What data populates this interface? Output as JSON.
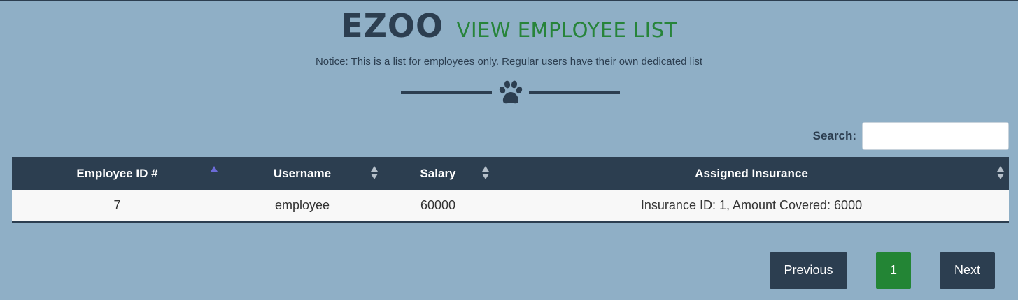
{
  "header": {
    "brand": "EZOO",
    "subtitle": "VIEW EMPLOYEE LIST",
    "notice": "Notice: This is a list for employees only. Regular users have their own dedicated list",
    "divider_icon": "paw-icon"
  },
  "search": {
    "label": "Search:",
    "value": "",
    "placeholder": ""
  },
  "table": {
    "columns": [
      {
        "label": "Employee ID #",
        "sort": "ascending"
      },
      {
        "label": "Username",
        "sort": "none"
      },
      {
        "label": "Salary",
        "sort": "none"
      },
      {
        "label": "Assigned Insurance",
        "sort": "none"
      }
    ],
    "rows": [
      {
        "id": "7",
        "username": "employee",
        "salary": "60000",
        "insurance": "Insurance ID: 1, Amount Covered: 6000"
      }
    ]
  },
  "pagination": {
    "previous_label": "Previous",
    "current_page": "1",
    "next_label": "Next"
  },
  "colors": {
    "background": "#8fafc6",
    "navy": "#2c3e50",
    "green": "#27843a",
    "page_active": "#238535"
  }
}
